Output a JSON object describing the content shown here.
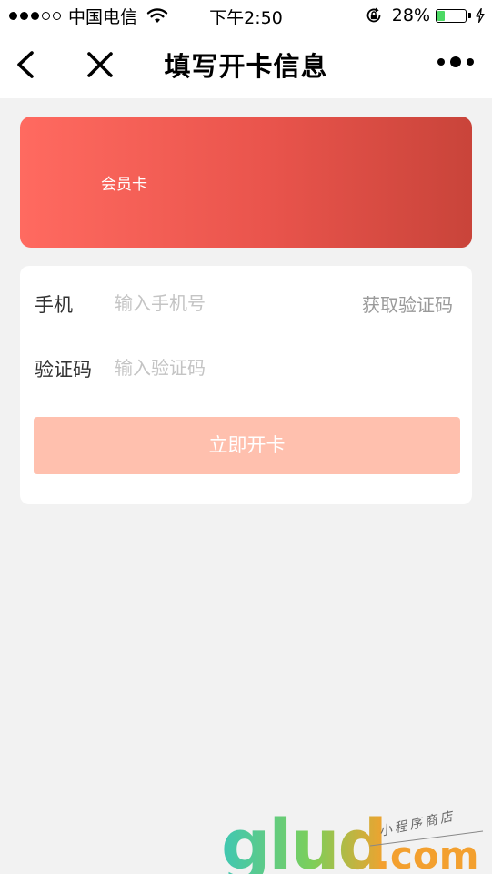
{
  "status_bar": {
    "carrier": "中国电信",
    "time": "下午2:50",
    "battery_percent": "28%",
    "battery_level": 0.28
  },
  "nav": {
    "title": "填写开卡信息"
  },
  "card": {
    "title": "会员卡"
  },
  "form": {
    "phone": {
      "label": "手机",
      "placeholder": "输入手机号",
      "value": ""
    },
    "get_code_label": "获取验证码",
    "code": {
      "label": "验证码",
      "placeholder": "输入验证码",
      "value": ""
    },
    "submit_label": "立即开卡"
  },
  "watermark": {
    "brand": "glud.com",
    "tagline": "小程序商店"
  },
  "colors": {
    "card_gradient_start": "#ff6a60",
    "card_gradient_end": "#c9443a",
    "submit_bg": "#ffc0ae",
    "battery_green": "#4cd964",
    "page_bg": "#f2f2f2"
  }
}
